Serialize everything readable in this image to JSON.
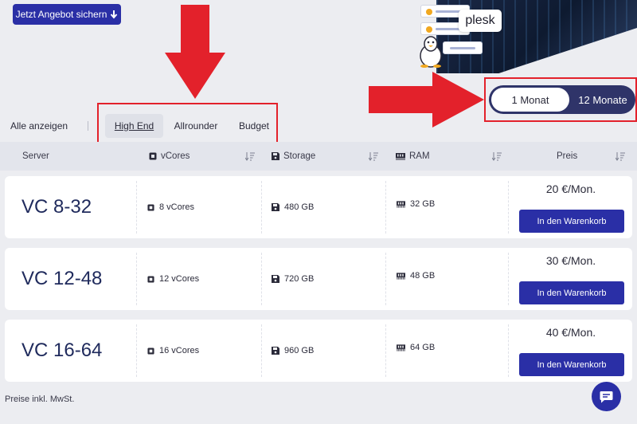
{
  "cta": {
    "label": "Jetzt Angebot sichern"
  },
  "hero": {
    "plesk_label": "plesk"
  },
  "billing_toggle": {
    "option_1": "1 Monat",
    "option_2": "12 Monate",
    "selected": "1 Monat"
  },
  "filters": {
    "all_label": "Alle anzeigen",
    "tabs": [
      {
        "label": "High End",
        "active": true
      },
      {
        "label": "Allrounder",
        "active": false
      },
      {
        "label": "Budget",
        "active": false
      }
    ]
  },
  "table": {
    "headers": {
      "server": "Server",
      "vcores": "vCores",
      "storage": "Storage",
      "ram": "RAM",
      "price": "Preis"
    },
    "rows": [
      {
        "name": "VC 8-32",
        "vcores": "8 vCores",
        "storage": "480 GB",
        "ram": "32 GB",
        "price": "20 €/Mon.",
        "cart_label": "In den Warenkorb"
      },
      {
        "name": "VC 12-48",
        "vcores": "12 vCores",
        "storage": "720 GB",
        "ram": "48 GB",
        "price": "30 €/Mon.",
        "cart_label": "In den Warenkorb"
      },
      {
        "name": "VC 16-64",
        "vcores": "16 vCores",
        "storage": "960 GB",
        "ram": "64 GB",
        "price": "40 €/Mon.",
        "cart_label": "In den Warenkorb"
      }
    ]
  },
  "footer": {
    "note": "Preise inkl. MwSt."
  },
  "colors": {
    "accent": "#2a2fa6",
    "annotation_red": "#e3212b",
    "toggle_dark": "#2f3469"
  },
  "icons": [
    "arrow-down-icon",
    "cpu-icon",
    "floppy-icon",
    "ram-icon",
    "sort-icon",
    "chat-icon",
    "linux-tux-icon"
  ]
}
